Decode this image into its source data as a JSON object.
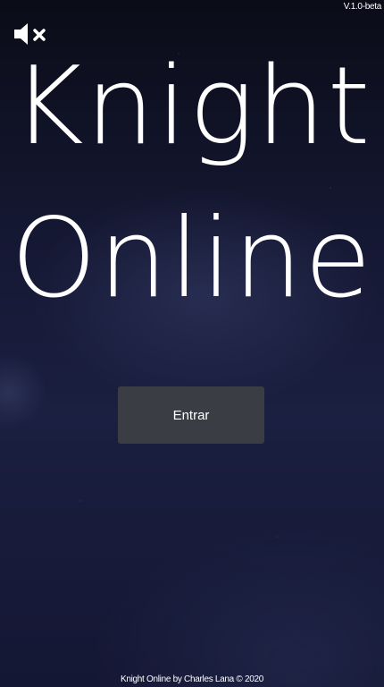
{
  "version": "V.1.0-beta",
  "title": {
    "line1": "Knight",
    "line2": "Online"
  },
  "enter_button": {
    "label": "Entrar"
  },
  "sound_toggle": {
    "icon": "speaker-muted-icon"
  },
  "footer": {
    "credit": "Knight Online by Charles Lana © 2020"
  }
}
